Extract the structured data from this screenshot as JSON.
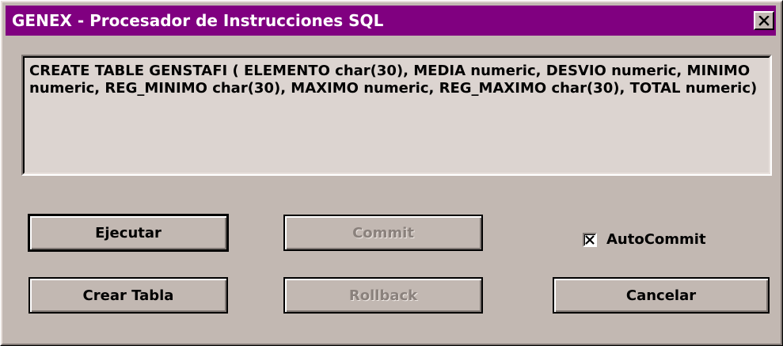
{
  "window": {
    "title": "GENEX - Procesador de Instrucciones SQL",
    "title_bar_color": "#800080",
    "close_icon": "close-icon"
  },
  "sql_editor": {
    "value": "CREATE TABLE GENSTAFI ( ELEMENTO char(30), MEDIA numeric, DESVIO numeric, MINIMO numeric, REG_MINIMO char(30), MAXIMO numeric, REG_MAXIMO char(30), TOTAL numeric)"
  },
  "buttons": {
    "ejecutar": "Ejecutar",
    "commit": "Commit",
    "crear_tabla": "Crear Tabla",
    "rollback": "Rollback",
    "cancelar": "Cancelar"
  },
  "autocommit": {
    "label": "AutoCommit",
    "checked": true
  }
}
